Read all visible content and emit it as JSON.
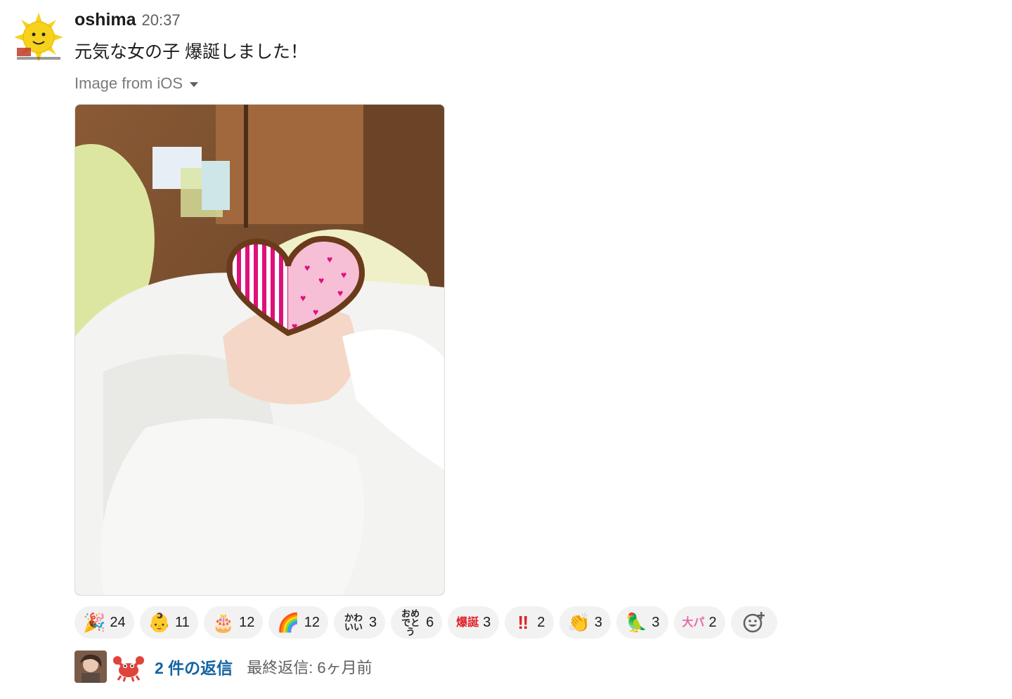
{
  "message": {
    "author": "oshima",
    "time": "20:37",
    "text": "元気な女の子 爆誕しました！",
    "file_label": "Image from iOS"
  },
  "reactions": [
    {
      "icon": "party-popper-icon",
      "emoji": "🎉",
      "count": "24"
    },
    {
      "icon": "baby-icon",
      "emoji": "👶",
      "count": "11"
    },
    {
      "icon": "birthday-cake-icon",
      "emoji": "🎂",
      "count": "12"
    },
    {
      "icon": "rainbow-person-icon",
      "emoji": "🌈",
      "count": "12"
    },
    {
      "icon": "kawaii-text-icon",
      "emoji": "かわいい",
      "count": "3"
    },
    {
      "icon": "omedetou-text-icon",
      "emoji": "おめでとう",
      "count": "6"
    },
    {
      "icon": "bakutan-text-icon",
      "emoji": "爆誕",
      "count": "3"
    },
    {
      "icon": "double-exclamation-icon",
      "emoji": "‼",
      "count": "2"
    },
    {
      "icon": "clapping-hands-icon",
      "emoji": "👏",
      "count": "3"
    },
    {
      "icon": "green-parrot-icon",
      "emoji": "🦜",
      "count": "3"
    },
    {
      "icon": "daikansha-text-icon",
      "emoji": "大パ",
      "count": "2"
    }
  ],
  "thread": {
    "reply_count": "2 件の返信",
    "last_reply": "最終返信: 6ヶ月前"
  },
  "colors": {
    "link": "#1264a3",
    "reaction_bg": "#f2f2f2"
  }
}
